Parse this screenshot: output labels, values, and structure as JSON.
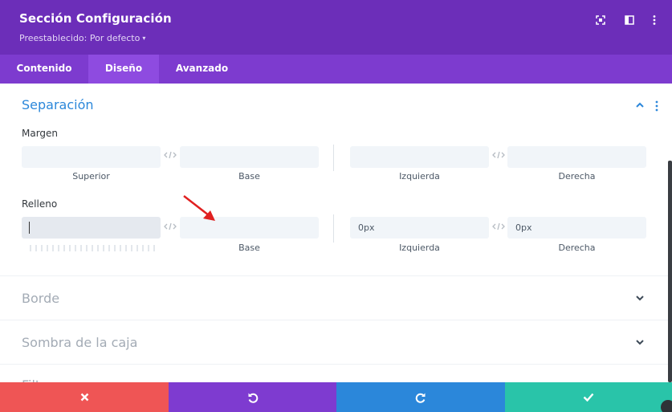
{
  "header": {
    "title": "Sección Configuración",
    "preset_label": "Preestablecido: Por defecto",
    "preset_caret": "▾",
    "icons": [
      "fullscreen-icon",
      "split-view-icon",
      "more-vertical-icon"
    ]
  },
  "tabs": [
    {
      "label": "Contenido",
      "active": false
    },
    {
      "label": "Diseño",
      "active": true
    },
    {
      "label": "Avanzado",
      "active": false
    }
  ],
  "spacing": {
    "title": "Separación",
    "margin": {
      "label": "Margen",
      "top": {
        "value": "",
        "sublabel": "Superior"
      },
      "bottom": {
        "value": "",
        "sublabel": "Base"
      },
      "left": {
        "value": "",
        "sublabel": "Izquierda"
      },
      "right": {
        "value": "",
        "sublabel": "Derecha"
      }
    },
    "padding": {
      "label": "Relleno",
      "top": {
        "value": "",
        "sublabel": ""
      },
      "bottom": {
        "value": "",
        "sublabel": "Base"
      },
      "left": {
        "value": "0px",
        "sublabel": "Izquierda"
      },
      "right": {
        "value": "0px",
        "sublabel": "Derecha"
      }
    }
  },
  "sections": [
    {
      "title": "Borde"
    },
    {
      "title": "Sombra de la caja"
    },
    {
      "title": "Filtros"
    }
  ],
  "footer": {
    "buttons": [
      {
        "name": "cancel",
        "icon": "close-icon",
        "color": "#ef5555"
      },
      {
        "name": "undo",
        "icon": "undo-icon",
        "color": "#7e3bd0"
      },
      {
        "name": "redo",
        "icon": "redo-icon",
        "color": "#2b87da"
      },
      {
        "name": "save",
        "icon": "check-icon",
        "color": "#29c4a9"
      }
    ]
  },
  "colors": {
    "header_bg": "#6c2eb9",
    "tabs_bg": "#7d3bcf",
    "active_tab_bg": "#8e4be0",
    "section_title_active": "#2b87da",
    "section_title_collapsed": "#a3abb5",
    "annotation_arrow": "#e02020"
  }
}
